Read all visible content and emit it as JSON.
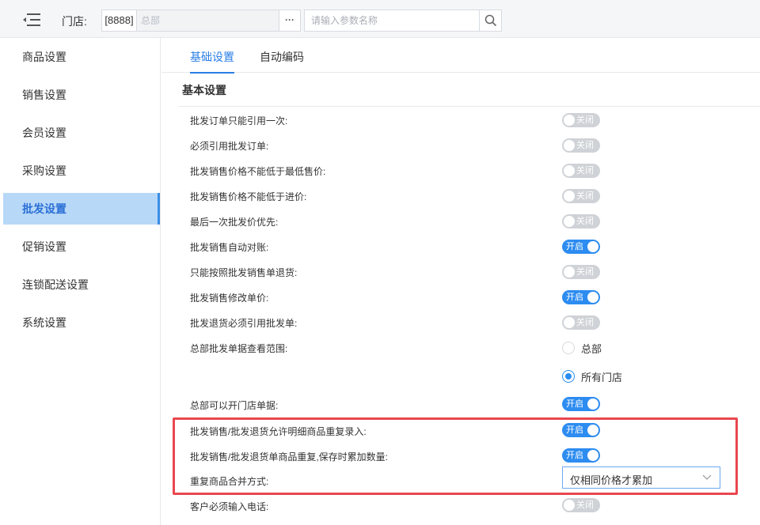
{
  "header": {
    "store_label": "门店:",
    "store_code": "[8888]",
    "store_name": "总部",
    "store_more": "···",
    "search_placeholder": "请输入参数名称"
  },
  "sidebar": {
    "items": [
      {
        "label": "商品设置",
        "active": false
      },
      {
        "label": "销售设置",
        "active": false
      },
      {
        "label": "会员设置",
        "active": false
      },
      {
        "label": "采购设置",
        "active": false
      },
      {
        "label": "批发设置",
        "active": true
      },
      {
        "label": "促销设置",
        "active": false
      },
      {
        "label": "连锁配送设置",
        "active": false
      },
      {
        "label": "系统设置",
        "active": false
      }
    ]
  },
  "tabs": [
    {
      "label": "基础设置",
      "active": true
    },
    {
      "label": "自动编码",
      "active": false
    }
  ],
  "section_title": "基本设置",
  "settings": [
    {
      "label": "批发订单只能引用一次:",
      "state": "关闭",
      "on": false
    },
    {
      "label": "必须引用批发订单:",
      "state": "关闭",
      "on": false
    },
    {
      "label": "批发销售价格不能低于最低售价:",
      "state": "关闭",
      "on": false
    },
    {
      "label": "批发销售价格不能低于进价:",
      "state": "关闭",
      "on": false
    },
    {
      "label": "最后一次批发价优先:",
      "state": "关闭",
      "on": false
    },
    {
      "label": "批发销售自动对账:",
      "state": "开启",
      "on": true
    },
    {
      "label": "只能按照批发销售单退货:",
      "state": "关闭",
      "on": false
    },
    {
      "label": "批发销售修改单价:",
      "state": "开启",
      "on": true
    },
    {
      "label": "批发退货必须引用批发单:",
      "state": "关闭",
      "on": false
    }
  ],
  "scope": {
    "label": "总部批发单据查看范围:",
    "options": [
      {
        "label": "总部",
        "checked": false
      },
      {
        "label": "所有门店",
        "checked": true
      }
    ]
  },
  "settings2": [
    {
      "label": "总部可以开门店单据:",
      "state": "开启",
      "on": true
    },
    {
      "label": "批发销售/批发退货允许明细商品重复录入:",
      "state": "开启",
      "on": true
    },
    {
      "label": "批发销售/批发退货单商品重复,保存时累加数量:",
      "state": "开启",
      "on": true
    }
  ],
  "merge": {
    "label": "重复商品合并方式:",
    "value": "仅相同价格才累加"
  },
  "settings3": [
    {
      "label": "客户必须输入电话:",
      "state": "关闭",
      "on": false
    }
  ],
  "colors": {
    "accent": "#2d8cf0",
    "sidebar_active_bg": "#b8d8f7",
    "highlight_border": "#e9474f",
    "toggle_off": "#cfd2d6"
  }
}
